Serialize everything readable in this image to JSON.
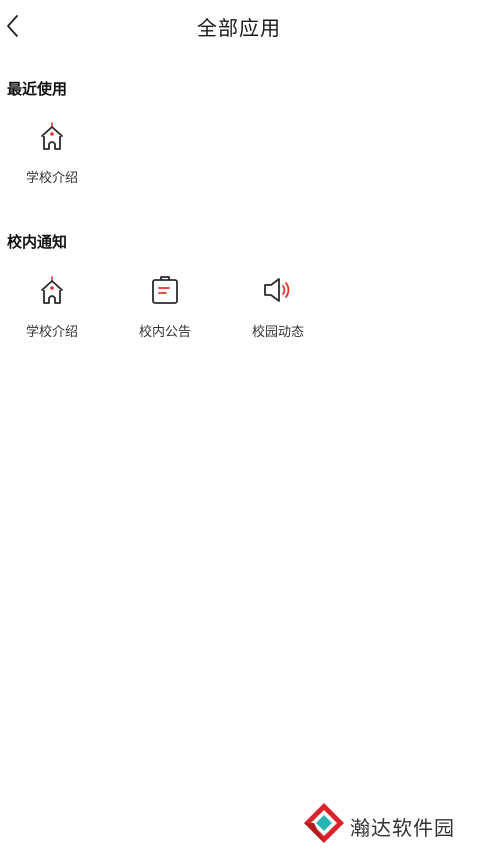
{
  "header": {
    "title": "全部应用",
    "back_icon": "chevron-left-icon"
  },
  "sections": [
    {
      "title": "最近使用",
      "items": [
        {
          "label": "学校介绍",
          "icon": "school-building-icon"
        }
      ]
    },
    {
      "title": "校内通知",
      "items": [
        {
          "label": "学校介绍",
          "icon": "school-building-icon"
        },
        {
          "label": "校内公告",
          "icon": "notice-board-icon"
        },
        {
          "label": "校园动态",
          "icon": "speaker-icon"
        }
      ]
    }
  ],
  "watermark": {
    "text": "瀚达软件园",
    "logo": "handa-logo-icon"
  },
  "colors": {
    "accent": "#e8322f",
    "icon_stroke": "#2b2b2b",
    "text": "#333333",
    "logo_red": "#d8242a",
    "logo_teal": "#2ab3b3"
  }
}
